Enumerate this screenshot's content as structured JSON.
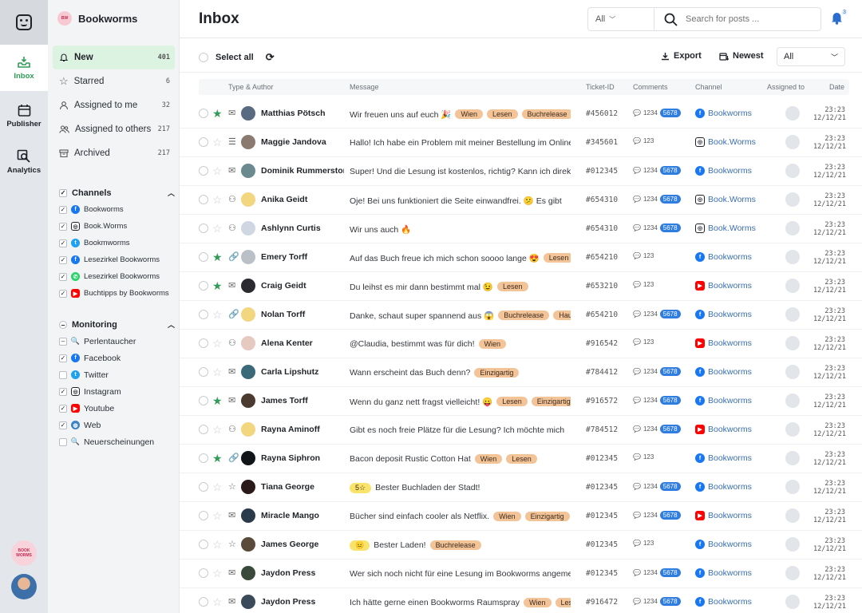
{
  "rail": {
    "inbox": "Inbox",
    "publisher": "Publisher",
    "analytics": "Analytics",
    "brand_short": "BOOK WORMS"
  },
  "brand": {
    "name": "Bookworms"
  },
  "nav": [
    {
      "label": "New",
      "count": "401",
      "icon": "bell-icon"
    },
    {
      "label": "Starred",
      "count": "6",
      "icon": "star-icon"
    },
    {
      "label": "Assigned to me",
      "count": "32",
      "icon": "user-icon"
    },
    {
      "label": "Assigned to others",
      "count": "217",
      "icon": "users-icon"
    },
    {
      "label": "Archived",
      "count": "217",
      "icon": "archive-icon"
    }
  ],
  "channels": {
    "title": "Channels",
    "items": [
      {
        "label": "Bookworms",
        "icon": "facebook-icon"
      },
      {
        "label": "Book.Worms",
        "icon": "instagram-icon"
      },
      {
        "label": "Bookmworms",
        "icon": "twitter-icon"
      },
      {
        "label": "Lesezirkel Bookworms",
        "icon": "facebook-icon"
      },
      {
        "label": "Lesezirkel Bookworms",
        "icon": "whatsapp-icon"
      },
      {
        "label": "Buchtipps by Bookworms",
        "icon": "youtube-icon"
      }
    ]
  },
  "monitoring": {
    "title": "Monitoring",
    "items": [
      {
        "label": "Perlentaucher",
        "icon": "search-icon",
        "check": "partial"
      },
      {
        "label": "Facebook",
        "icon": "facebook-icon",
        "check": "on"
      },
      {
        "label": "Twitter",
        "icon": "twitter-icon",
        "check": "off"
      },
      {
        "label": "Instagram",
        "icon": "instagram-icon",
        "check": "on"
      },
      {
        "label": "Youtube",
        "icon": "youtube-icon",
        "check": "on"
      },
      {
        "label": "Web",
        "icon": "globe-icon",
        "check": "on"
      },
      {
        "label": "Neuerscheinungen",
        "icon": "search-icon",
        "check": "off"
      }
    ]
  },
  "header": {
    "title": "Inbox",
    "filter": "All",
    "search_placeholder": "Search for posts ...",
    "notifications": "3"
  },
  "toolbar": {
    "select_all": "Select all",
    "export": "Export",
    "sort": "Newest",
    "dropdown": "All"
  },
  "columns": {
    "type": "Type & Author",
    "message": "Message",
    "ticket": "Ticket-ID",
    "comments": "Comments",
    "channel": "Channel",
    "assigned": "Assigned to",
    "date": "Date"
  },
  "rows": [
    {
      "star": true,
      "type": "mail",
      "avatar": "#5a6a80",
      "author": "Matthias Pötsch",
      "msg": "Wir freuen uns auf euch 🎉",
      "tags": [
        "Wien",
        "Lesen",
        "Buchrelease"
      ],
      "ticket": "#456012",
      "comments": "1234",
      "pill": "5678",
      "ch": "fb",
      "channel": "Bookworms",
      "time": "23:23",
      "date": "12/12/21"
    },
    {
      "star": false,
      "type": "list",
      "avatar": "#8a7a70",
      "author": "Maggie Jandova",
      "msg": "Hallo! Ich habe ein Problem mit meiner Bestellung im Onlineshop",
      "tags": [],
      "ticket": "#345601",
      "comments": "123",
      "pill": "",
      "ch": "ig",
      "channel": "Book.Worms",
      "time": "23:23",
      "date": "12/12/21"
    },
    {
      "star": false,
      "type": "mail",
      "avatar": "#6a8a90",
      "author": "Dominik Rummerstorfer",
      "msg": "Super! Und die Lesung ist kostenlos, richtig? Kann ich direkt kommen?",
      "tags": [],
      "ticket": "#012345",
      "comments": "1234",
      "pill": "5678",
      "ch": "fb",
      "channel": "Bookworms",
      "time": "23:23",
      "date": "12/12/21"
    },
    {
      "star": false,
      "type": "group",
      "avatar": "#f2d680",
      "author": "Anika Geidt",
      "msg": "Oje! Bei uns funktioniert die Seite einwandfrei. 😕 Es gibt",
      "tags": [],
      "ticket": "#654310",
      "comments": "1234",
      "pill": "5678",
      "ch": "ig",
      "channel": "Book.Worms",
      "time": "23:23",
      "date": "12/12/21"
    },
    {
      "star": false,
      "type": "group",
      "avatar": "#cfd8e2",
      "author": "Ashlynn Curtis",
      "msg": "Wir uns auch 🔥",
      "tags": [],
      "ticket": "#654310",
      "comments": "1234",
      "pill": "5678",
      "ch": "ig",
      "channel": "Book.Worms",
      "time": "23:23",
      "date": "12/12/21"
    },
    {
      "star": true,
      "type": "link",
      "avatar": "#b9c0c8",
      "author": "Emery Torff",
      "msg": "Auf das Buch freue ich mich schon soooo lange 😍",
      "tags": [
        "Lesen"
      ],
      "ticket": "#654210",
      "comments": "123",
      "pill": "",
      "ch": "fb",
      "channel": "Bookworms",
      "time": "23:23",
      "date": "12/12/21"
    },
    {
      "star": true,
      "type": "mail",
      "avatar": "#2a2a30",
      "author": "Craig Geidt",
      "msg": "Du leihst es mir dann bestimmt mal 😉",
      "tags": [
        "Lesen"
      ],
      "ticket": "#653210",
      "comments": "123",
      "pill": "",
      "ch": "yt",
      "channel": "Bookworms",
      "time": "23:23",
      "date": "12/12/21"
    },
    {
      "star": false,
      "type": "link",
      "avatar": "#f2d680",
      "author": "Nolan Torff",
      "msg": "Danke, schaut super spannend aus 😱",
      "tags": [
        "Buchrelease",
        "Haus"
      ],
      "ticket": "#654210",
      "comments": "1234",
      "pill": "5678",
      "ch": "fb",
      "channel": "Bookworms",
      "time": "23:23",
      "date": "12/12/21"
    },
    {
      "star": false,
      "type": "group",
      "avatar": "#e6c9c0",
      "author": "Alena Kenter",
      "msg": "@Claudia, bestimmt was für dich!",
      "tags": [
        "Wien"
      ],
      "ticket": "#916542",
      "comments": "123",
      "pill": "",
      "ch": "yt",
      "channel": "Bookworms",
      "time": "23:23",
      "date": "12/12/21"
    },
    {
      "star": false,
      "type": "mail",
      "avatar": "#3a6a7a",
      "author": "Carla Lipshutz",
      "msg": "Wann erscheint das Buch denn?",
      "tags": [
        "Einzigartig"
      ],
      "ticket": "#784412",
      "comments": "1234",
      "pill": "5678",
      "ch": "fb",
      "channel": "Bookworms",
      "time": "23:23",
      "date": "12/12/21"
    },
    {
      "star": true,
      "type": "mail",
      "avatar": "#4a3a30",
      "author": "James Torff",
      "msg": "Wenn du ganz nett fragst vielleicht! 😛",
      "tags": [
        "Lesen",
        "Einzigartig"
      ],
      "ticket": "#916572",
      "comments": "1234",
      "pill": "5678",
      "ch": "fb",
      "channel": "Bookworms",
      "time": "23:23",
      "date": "12/12/21"
    },
    {
      "star": false,
      "type": "group",
      "avatar": "#f2d680",
      "author": "Rayna Aminoff",
      "msg": "Gibt es noch freie Plätze für die Lesung? Ich möchte mich",
      "tags": [],
      "ticket": "#784512",
      "comments": "1234",
      "pill": "5678",
      "ch": "yt",
      "channel": "Bookworms",
      "time": "23:23",
      "date": "12/12/21"
    },
    {
      "star": true,
      "type": "link",
      "avatar": "#111418",
      "author": "Rayna Siphron",
      "msg": "Bacon deposit Rustic Cotton Hat",
      "tags": [
        "Wien",
        "Lesen"
      ],
      "ticket": "#012345",
      "comments": "123",
      "pill": "",
      "ch": "fb",
      "channel": "Bookworms",
      "time": "23:23",
      "date": "12/12/21"
    },
    {
      "star": false,
      "type": "star",
      "avatar": "#2a1a1a",
      "author": "Tiana George",
      "msg": "Bester Buchladen der Stadt!",
      "rating": "5☆",
      "tags": [],
      "ticket": "#012345",
      "comments": "1234",
      "pill": "5678",
      "ch": "fb",
      "channel": "Bookworms",
      "time": "23:23",
      "date": "12/12/21"
    },
    {
      "star": false,
      "type": "mail",
      "avatar": "#2a3a4a",
      "author": "Miracle Mango",
      "msg": "Bücher sind einfach cooler als Netflix.",
      "tags": [
        "Wien",
        "Einzigartig"
      ],
      "ticket": "#012345",
      "comments": "1234",
      "pill": "5678",
      "ch": "yt",
      "channel": "Bookworms",
      "time": "23:23",
      "date": "12/12/21"
    },
    {
      "star": false,
      "type": "star",
      "avatar": "#5a4a3a",
      "author": "James George",
      "msg": "Bester Laden!",
      "rating": "😐",
      "tags": [
        "Buchrelease"
      ],
      "ticket": "#012345",
      "comments": "123",
      "pill": "",
      "ch": "fb",
      "channel": "Bookworms",
      "time": "23:23",
      "date": "12/12/21"
    },
    {
      "star": false,
      "type": "mail",
      "avatar": "#3a4a3a",
      "author": "Jaydon Press",
      "msg": "Wer sich noch nicht für eine Lesung im Bookworms angemeldet",
      "tags": [],
      "ticket": "#012345",
      "comments": "1234",
      "pill": "5678",
      "ch": "fb",
      "channel": "Bookworms",
      "time": "23:23",
      "date": "12/12/21"
    },
    {
      "star": false,
      "type": "mail",
      "avatar": "#3a4a5a",
      "author": "Jaydon Press",
      "msg": "Ich hätte gerne einen Bookworms Raumspray",
      "tags": [
        "Wien",
        "Lesen"
      ],
      "ticket": "#916472",
      "comments": "1234",
      "pill": "5678",
      "ch": "fb",
      "channel": "Bookworms",
      "time": "23:23",
      "date": "12/12/21"
    }
  ]
}
